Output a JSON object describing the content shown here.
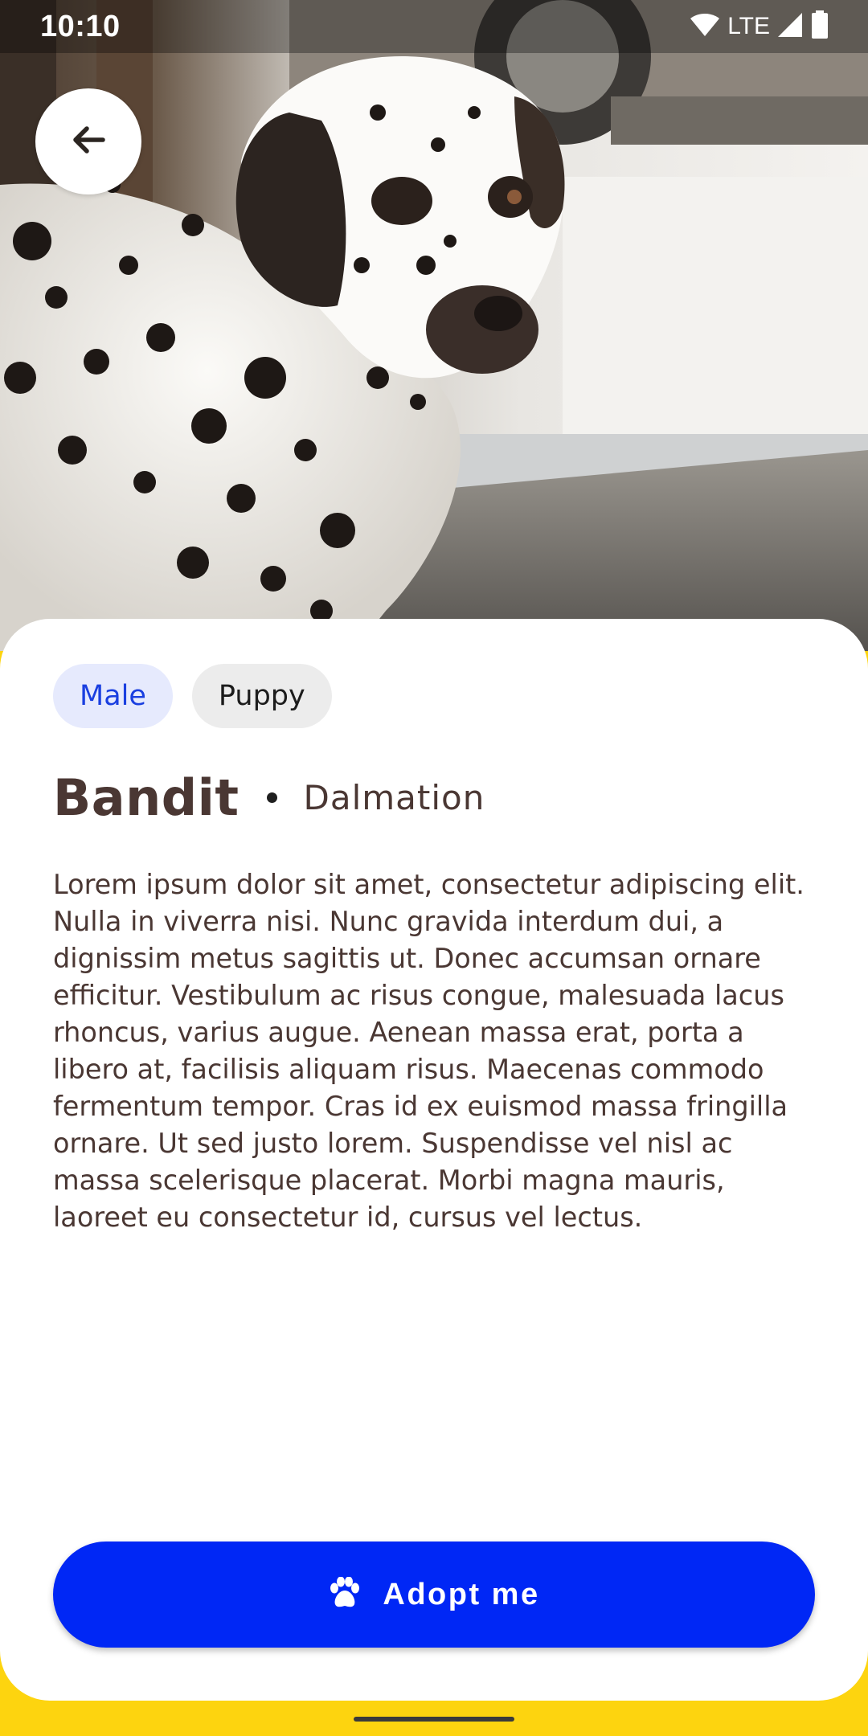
{
  "status_bar": {
    "time": "10:10",
    "network": "LTE",
    "icons": [
      "wifi-icon",
      "cell-signal-icon",
      "battery-icon"
    ]
  },
  "hero": {
    "description_icon": "dalmatian-photo"
  },
  "navigation": {
    "back_icon": "arrow-left-icon"
  },
  "pet": {
    "tags": [
      {
        "label": "Male",
        "color": "#1a3fe0",
        "background": "#e6eafd"
      },
      {
        "label": "Puppy",
        "color": "#1c1c1c",
        "background": "#ececec"
      }
    ],
    "name": "Bandit",
    "breed": "Dalmation",
    "description": "Lorem ipsum dolor sit amet, consectetur adipiscing elit. Nulla in viverra nisi. Nunc gravida interdum dui, a dignissim metus sagittis ut. Donec accumsan ornare efficitur. Vestibulum ac risus congue, malesuada lacus rhoncus, varius augue. Aenean massa erat, porta a libero at, facilisis aliquam risus. Maecenas commodo fermentum tempor. Cras id ex euismod massa fringilla ornare. Ut sed justo lorem. Suspendisse vel nisl ac massa scelerisque placerat. Morbi magna mauris, laoreet eu consectetur id, cursus vel lectus."
  },
  "actions": {
    "adopt_label": "Adopt me",
    "adopt_icon": "paw-icon"
  },
  "colors": {
    "accent": "#0027f5",
    "background": "#fdd40f",
    "text": "#4a3733"
  }
}
